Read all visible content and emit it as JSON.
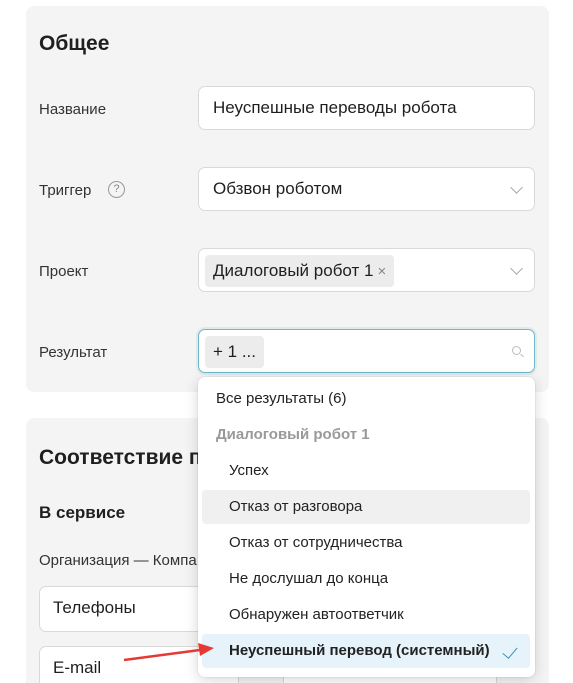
{
  "general": {
    "title": "Общее",
    "name_label": "Название",
    "name_value": "Неуспешные переводы робота",
    "trigger_label": "Триггер",
    "trigger_help": "?",
    "trigger_value": "Обзвон роботом",
    "project_label": "Проект",
    "project_tag": "Диалоговый робот 1",
    "project_tag_remove": "×",
    "result_label": "Результат",
    "result_tag": "+ 1 ..."
  },
  "mapping": {
    "title": "Соответствие п",
    "subtitle": "В сервисе",
    "org_label": "Организация — Компа",
    "phones_value": "Телефоны",
    "email_value": "E-mail"
  },
  "dropdown": {
    "all_results": "Все результаты (6)",
    "group_label": "Диалоговый робот 1",
    "options": [
      "Успех",
      "Отказ от разговора",
      "Отказ от сотрудничества",
      "Не дослушал до конца",
      "Обнаружен автоответчик",
      "Неуспешный перевод (системный)"
    ]
  },
  "colors": {
    "accent": "#3a8fc1",
    "arrow": "#e53935",
    "card_bg": "#f4f4f4"
  }
}
